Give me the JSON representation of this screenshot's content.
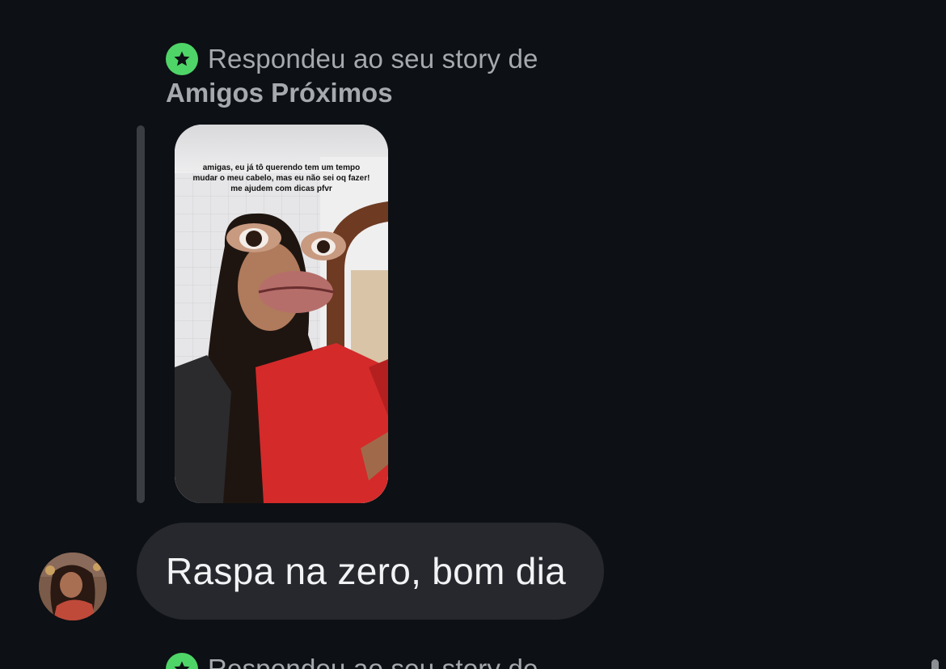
{
  "colors": {
    "background": "#0d1014",
    "star_badge": "#4fd468",
    "reply_text": "#a6a9ae",
    "bubble": "#26282d",
    "bubble_text": "#f2f3f5"
  },
  "reply_header": {
    "icon": "star-icon",
    "prefix": "Respondeu ao seu story de",
    "audience": "Amigos Próximos"
  },
  "story": {
    "caption": "amigas, eu já tô querendo tem um tempo\nmudar o meu cabelo, mas eu não sei oq fazer!\nme ajudem com dicas pfvr"
  },
  "message": {
    "text": "Raspa na zero, bom dia",
    "sender_avatar": "avatar-photo"
  },
  "next_reply_header": {
    "icon": "star-icon",
    "prefix": "Respondeu ao seu story de"
  }
}
